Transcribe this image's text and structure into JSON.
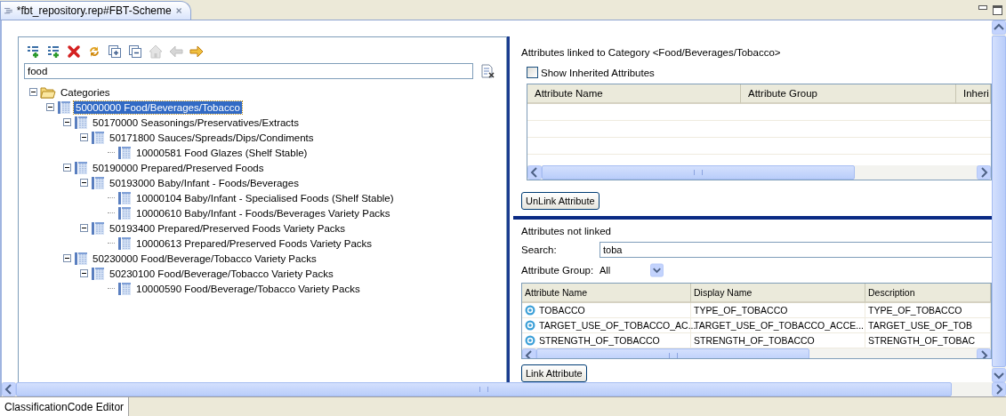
{
  "editor_tab": {
    "title": "*fbt_repository.rep#FBT-Scheme"
  },
  "toolbar": [
    {
      "kind": "add-child",
      "disabled": false
    },
    {
      "kind": "add-sibling",
      "disabled": false
    },
    {
      "kind": "delete",
      "disabled": false
    },
    {
      "kind": "refresh",
      "disabled": false
    },
    {
      "kind": "expand-all",
      "disabled": false
    },
    {
      "kind": "collapse-all",
      "disabled": false
    },
    {
      "kind": "home",
      "disabled": true
    },
    {
      "kind": "back",
      "disabled": true
    },
    {
      "kind": "forward",
      "disabled": false
    }
  ],
  "filter": {
    "value": "food"
  },
  "tree": [
    {
      "label": "Categories",
      "kind": "folder",
      "expanded": true,
      "selected": false,
      "children": [
        {
          "label": "50000000 Food/Beverages/Tobacco",
          "kind": "category",
          "expanded": true,
          "selected": true,
          "children": [
            {
              "label": "50170000 Seasonings/Preservatives/Extracts",
              "kind": "category",
              "expanded": true,
              "selected": false,
              "children": [
                {
                  "label": "50171800 Sauces/Spreads/Dips/Condiments",
                  "kind": "category",
                  "expanded": true,
                  "selected": false,
                  "children": [
                    {
                      "label": "10000581 Food Glazes (Shelf Stable)",
                      "kind": "category",
                      "selected": false
                    }
                  ]
                }
              ]
            },
            {
              "label": "50190000 Prepared/Preserved Foods",
              "kind": "category",
              "expanded": true,
              "selected": false,
              "children": [
                {
                  "label": "50193000 Baby/Infant - Foods/Beverages",
                  "kind": "category",
                  "expanded": true,
                  "selected": false,
                  "children": [
                    {
                      "label": "10000104 Baby/Infant - Specialised Foods (Shelf Stable)",
                      "kind": "category",
                      "selected": false
                    },
                    {
                      "label": "10000610 Baby/Infant - Foods/Beverages Variety Packs",
                      "kind": "category",
                      "selected": false
                    }
                  ]
                },
                {
                  "label": "50193400 Prepared/Preserved Foods Variety Packs",
                  "kind": "category",
                  "expanded": true,
                  "selected": false,
                  "children": [
                    {
                      "label": "10000613 Prepared/Preserved Foods Variety Packs",
                      "kind": "category",
                      "selected": false
                    }
                  ]
                }
              ]
            },
            {
              "label": "50230000 Food/Beverage/Tobacco Variety Packs",
              "kind": "category",
              "expanded": true,
              "selected": false,
              "children": [
                {
                  "label": "50230100 Food/Beverage/Tobacco Variety Packs",
                  "kind": "category",
                  "expanded": true,
                  "selected": false,
                  "children": [
                    {
                      "label": "10000590 Food/Beverage/Tobacco Variety Packs",
                      "kind": "category",
                      "selected": false
                    }
                  ]
                }
              ]
            }
          ]
        }
      ]
    }
  ],
  "linked": {
    "title": "Attributes linked to Category <Food/Beverages/Tobacco>",
    "show_inherited": {
      "label": "Show Inherited Attributes",
      "checked": false
    },
    "columns": [
      "Attribute Name",
      "Attribute Group",
      "Inheri"
    ],
    "button": "UnLink Attribute"
  },
  "unlinked": {
    "title": "Attributes not linked",
    "search": {
      "label": "Search:",
      "value": "toba"
    },
    "group": {
      "label": "Attribute Group:",
      "value": "All"
    },
    "columns": [
      "Attribute Name",
      "Display Name",
      "Description"
    ],
    "rows": [
      [
        "TOBACCO",
        "TYPE_OF_TOBACCO",
        "TYPE_OF_TOBACCO"
      ],
      [
        "TARGET_USE_OF_TOBACCO_AC...",
        "TARGET_USE_OF_TOBACCO_ACCE...",
        "TARGET_USE_OF_TOB"
      ],
      [
        "STRENGTH_OF_TOBACCO",
        "STRENGTH_OF_TOBACCO",
        "STRENGTH_OF_TOBAC"
      ]
    ],
    "button": "Link Attribute"
  },
  "bottom_tab": {
    "label": "ClassificationCode Editor"
  }
}
